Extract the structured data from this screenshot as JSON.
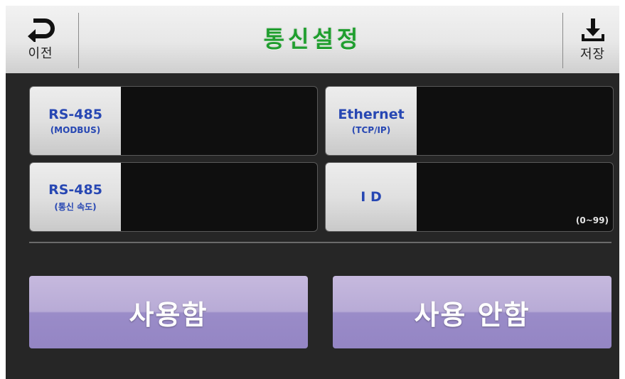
{
  "header": {
    "title": "통신설정",
    "back_label": "이전",
    "save_label": "저장"
  },
  "fields": [
    {
      "label": "RS-485",
      "sublabel": "(MODBUS)",
      "value": ""
    },
    {
      "label": "Ethernet",
      "sublabel": "(TCP/IP)",
      "value": ""
    },
    {
      "label": "RS-485",
      "sublabel": "(통신 속도)",
      "value": ""
    },
    {
      "label": "I D",
      "sublabel": "",
      "value": "",
      "range": "(0~99)"
    }
  ],
  "buttons": {
    "enable_label": "사용함",
    "disable_label": "사용 안함"
  },
  "colors": {
    "title": "#1f9e2e",
    "field_label": "#2747b3",
    "button": "#b8abd6"
  }
}
